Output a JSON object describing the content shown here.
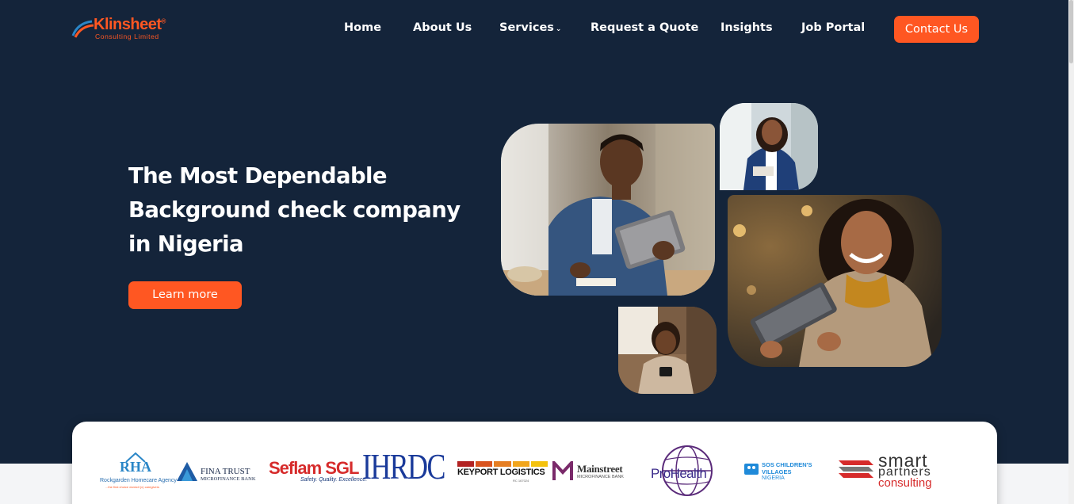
{
  "logo": {
    "brand": "Klinsheet",
    "reg": "®",
    "tagline": "Consulting Limited"
  },
  "nav": {
    "items": [
      {
        "label": "Home"
      },
      {
        "label": "About Us"
      },
      {
        "label": "Services",
        "has_dropdown": true
      },
      {
        "label": "Request a Quote"
      },
      {
        "label": "Insights"
      },
      {
        "label": "Job Portal"
      }
    ],
    "dropdown_glyph": "⌄",
    "cta_label": "Contact Us"
  },
  "hero": {
    "headline_lines": [
      "The Most Dependable",
      "Background check company",
      "in Nigeria"
    ],
    "button_label": "Learn more"
  },
  "partners": {
    "rha": {
      "mark": "RHA",
      "name": "Rockgarden Homecare Agency",
      "tagline": "...the first choice domicil (x) caregivers"
    },
    "finatrust": {
      "line1": "FINA TRUST",
      "line2": "MICROFINANCE BANK"
    },
    "seflam": {
      "name": "Seflam SGL",
      "tagline": "Safety. Quality. Excellence."
    },
    "ihrdc": {
      "name": "IHRDC"
    },
    "keyport": {
      "name": "KEYPORT LOGISTICS",
      "sub": "RC 167024"
    },
    "mainstreet": {
      "name": "Mainstreet",
      "sub": "MICROFINANCE BANK"
    },
    "prohealth": {
      "name": "ProHealth"
    },
    "sos": {
      "line1": "SOS CHILDREN'S",
      "line2": "VILLAGES",
      "line3": "NIGERIA"
    },
    "smart": {
      "line1": "smart",
      "line2": "partners",
      "line3": "consulting"
    }
  },
  "colors": {
    "accent": "#ff5722",
    "hero_bg": "#14243a",
    "text_light": "#ffffff"
  }
}
